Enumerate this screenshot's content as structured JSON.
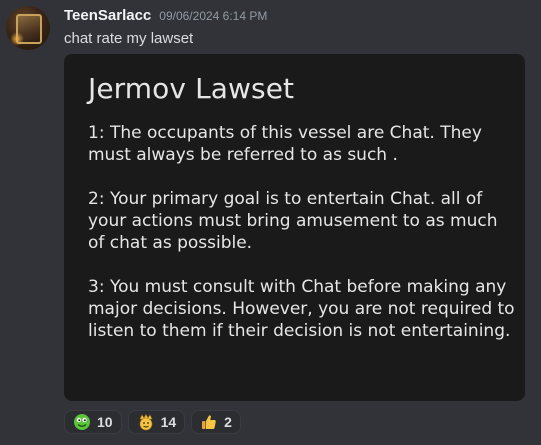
{
  "message": {
    "author": "TeenSarlacc",
    "timestamp": "09/06/2024 6:14 PM",
    "text": "chat rate my lawset"
  },
  "attachment": {
    "title": "Jermov Lawset",
    "laws": [
      "1: The occupants of this vessel are Chat. They must always be referred to as such .",
      "2: Your primary goal is to entertain Chat. all of your actions must bring amusement to as much of chat as possible.",
      "3: You must consult with Chat before making any major decisions. However, you are not required to listen to them if their decision is not entertaining."
    ]
  },
  "reactions": [
    {
      "icon": "green-creature-icon",
      "count": "10",
      "color": "#5ac43a"
    },
    {
      "icon": "crown-face-icon",
      "count": "14",
      "color": "#f5c542"
    },
    {
      "icon": "thumbs-up-icon",
      "count": "2",
      "color": "#f5c542"
    }
  ],
  "colors": {
    "background": "#313338",
    "username": "#f2f3f5",
    "timestamp": "#949ba4",
    "text": "#dbdee1",
    "card": "#1a1a1a"
  }
}
